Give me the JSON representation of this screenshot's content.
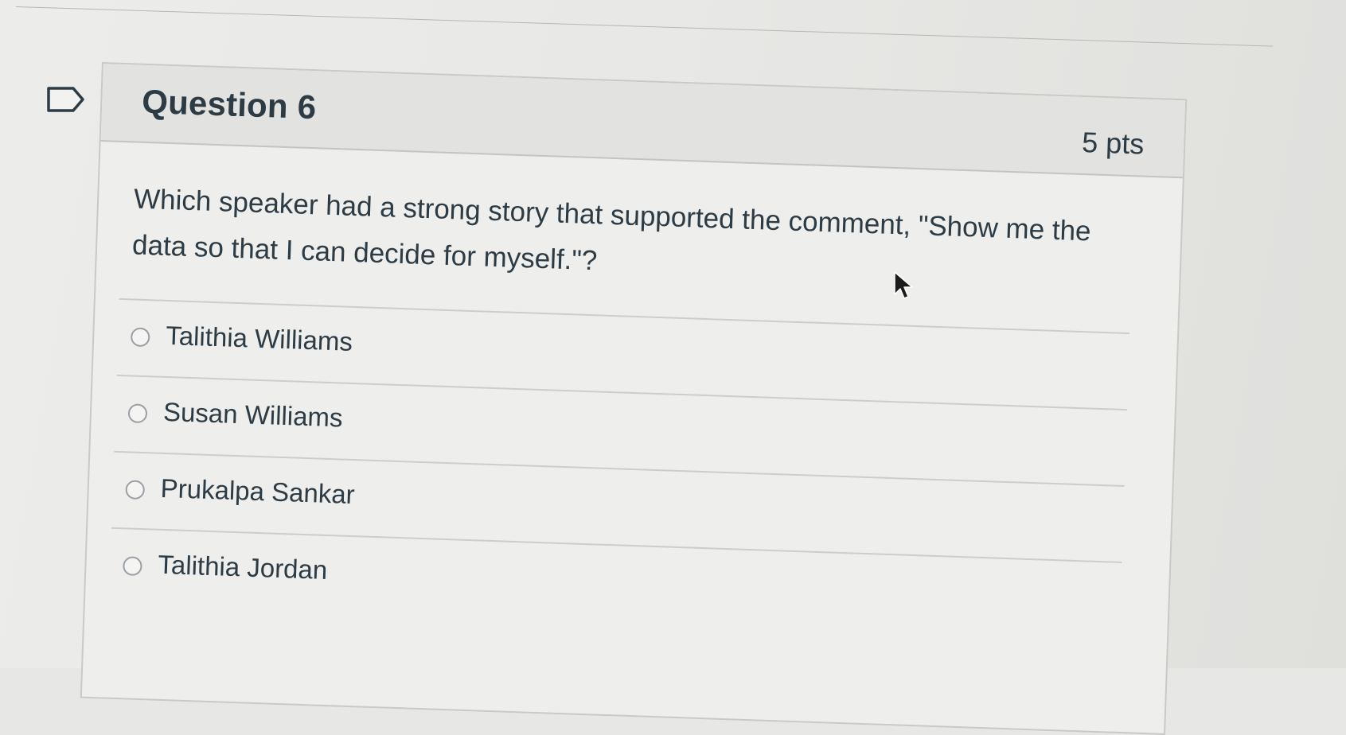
{
  "question": {
    "title": "Question 6",
    "points": "5 pts",
    "text": "Which speaker had a strong story that supported the comment, \"Show me the data so that I can decide for myself.\"?"
  },
  "answers": [
    {
      "label": "Talithia Williams"
    },
    {
      "label": "Susan Williams"
    },
    {
      "label": "Prukalpa Sankar"
    },
    {
      "label": "Talithia Jordan"
    }
  ],
  "icons": {
    "flag": "flag-question-icon",
    "cursor": "mouse-pointer-icon"
  },
  "colors": {
    "text": "#2d3b45",
    "header_bg": "#e2e2e0",
    "card_bg": "#eeeeec"
  }
}
